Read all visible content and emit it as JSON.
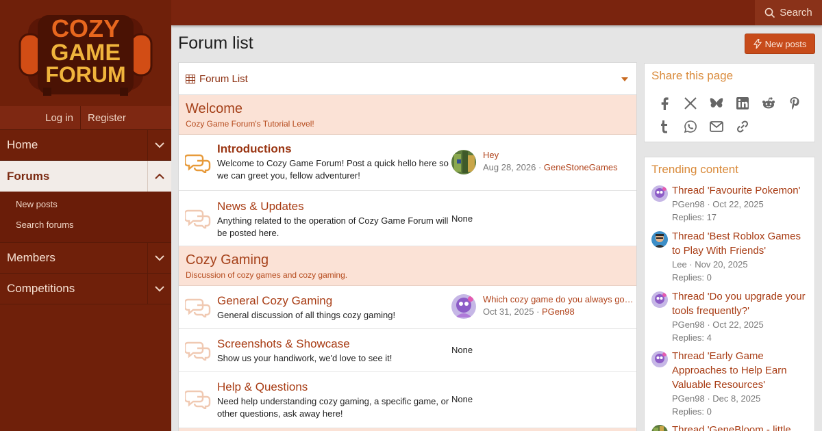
{
  "logo": {
    "line1": "COZY",
    "line2": "GAME",
    "line3": "FORUM"
  },
  "auth": {
    "login": "Log in",
    "register": "Register"
  },
  "nav": {
    "home": "Home",
    "forums": "Forums",
    "forums_sub": {
      "new_posts": "New posts",
      "search_forums": "Search forums"
    },
    "members": "Members",
    "competitions": "Competitions"
  },
  "topbar": {
    "search": "Search"
  },
  "page": {
    "title": "Forum list",
    "new_posts_btn": "New posts"
  },
  "forum_list": {
    "header": "Forum List",
    "categories": [
      {
        "title": "Welcome",
        "desc": "Cozy Game Forum's Tutorial Level!",
        "nodes": [
          {
            "title": "Introductions",
            "desc": "Welcome to Cozy Game Forum! Post a quick hello here so we can greet you, fellow adventurer!",
            "last_title": "Hey",
            "last_date": "Aug 28, 2026",
            "last_user": "GeneStoneGames",
            "unread": true
          },
          {
            "title": "News & Updates",
            "desc": "Anything related to the operation of Cozy Game Forum will be posted here.",
            "last_none": "None"
          }
        ]
      },
      {
        "title": "Cozy Gaming",
        "desc": "Discussion of cozy games and cozy gaming.",
        "nodes": [
          {
            "title": "General Cozy Gaming",
            "desc": "General discussion of all things cozy gaming!",
            "last_title": "Which cozy game do you always go back to?",
            "last_date": "Oct 31, 2025",
            "last_user": "PGen98"
          },
          {
            "title": "Screenshots & Showcase",
            "desc": "Show us your handiwork, we'd love to see it!",
            "last_none": "None"
          },
          {
            "title": "Help & Questions",
            "desc": "Need help understanding cozy gaming, a specific game, or other questions, ask away here!",
            "last_none": "None"
          }
        ]
      }
    ]
  },
  "share": {
    "title": "Share this page"
  },
  "trending": {
    "title": "Trending content",
    "items": [
      {
        "title": "Thread 'Favourite Pokemon'",
        "meta": "PGen98 · Oct 22, 2025",
        "replies": "Replies: 17"
      },
      {
        "title": "Thread 'Best Roblox Games to Play With Friends'",
        "meta": "Lee · Nov 20, 2025",
        "replies": "Replies: 0"
      },
      {
        "title": "Thread 'Do you upgrade your tools frequently?'",
        "meta": "PGen98 · Oct 22, 2025",
        "replies": "Replies: 4"
      },
      {
        "title": "Thread 'Early Game Approaches to Help Earn Valuable Resources'",
        "meta": "PGen98 · Dec 8, 2025",
        "replies": "Replies: 0"
      },
      {
        "title": "Thread 'GeneBloom - little",
        "meta": "",
        "replies": ""
      }
    ]
  },
  "colors": {
    "sidebar": "#6f200a",
    "topbar": "#7a240e",
    "accent": "#c74b1a",
    "link": "#a83c14",
    "category_bg": "#fbe2d6"
  }
}
